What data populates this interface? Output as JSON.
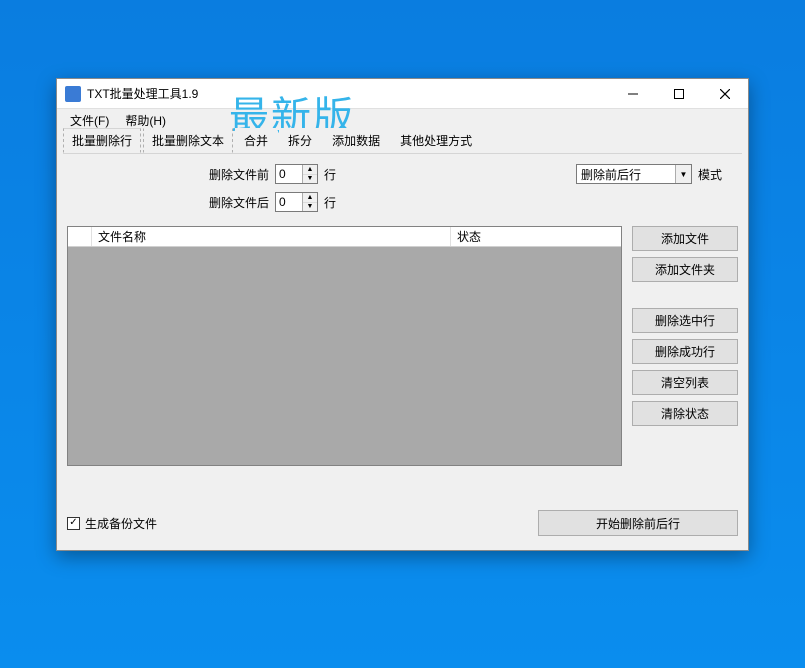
{
  "window": {
    "title": "TXT批量处理工具1.9",
    "watermark": "最新版"
  },
  "menubar": {
    "file": "文件(F)",
    "help": "帮助(H)"
  },
  "tabs": [
    {
      "label": "批量删除行",
      "active": true
    },
    {
      "label": "批量删除文本",
      "active": false
    },
    {
      "label": "合并",
      "active": false
    },
    {
      "label": "拆分",
      "active": false
    },
    {
      "label": "添加数据",
      "active": false
    },
    {
      "label": "其他处理方式",
      "active": false
    }
  ],
  "settings": {
    "delete_before_label": "删除文件前",
    "delete_before_value": "0",
    "delete_after_label": "删除文件后",
    "delete_after_value": "0",
    "lines_unit": "行",
    "mode_value": "删除前后行",
    "mode_label": "模式"
  },
  "table": {
    "col_blank": "",
    "col_filename": "文件名称",
    "col_status": "状态"
  },
  "buttons": {
    "add_file": "添加文件",
    "add_folder": "添加文件夹",
    "delete_selected": "删除选中行",
    "delete_success": "删除成功行",
    "clear_list": "清空列表",
    "clear_status": "清除状态"
  },
  "footer": {
    "backup_checkbox": "生成备份文件",
    "backup_checked": true,
    "start_button": "开始删除前后行"
  }
}
